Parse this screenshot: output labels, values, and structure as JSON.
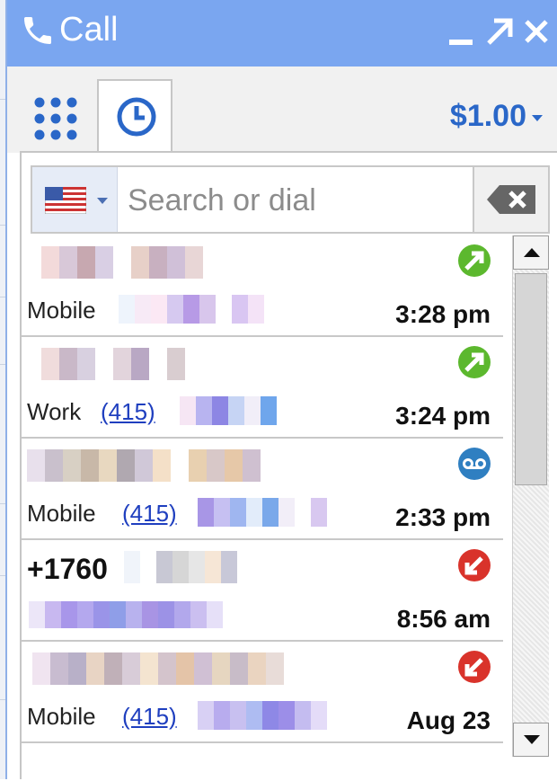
{
  "window": {
    "title": "Call",
    "phone_icon": "phone-icon",
    "minimize_icon": "minimize-icon",
    "popout_icon": "popout-icon",
    "close_icon": "close-icon",
    "color": "#7aa6f0"
  },
  "tabs": {
    "dialpad_icon": "dialpad-icon",
    "history_icon": "clock-icon",
    "credit": "$1.00"
  },
  "search": {
    "placeholder": "Search or dial",
    "value": "",
    "country_icon": "us-flag-icon",
    "clear_icon": "backspace-icon"
  },
  "calls": [
    {
      "name": "",
      "type": "Mobile",
      "area_code": "",
      "time": "3:28 pm",
      "status_icon": "outgoing-call-icon",
      "status_color": "#5cb82e"
    },
    {
      "name": "",
      "type": "Work",
      "area_code": "(415)",
      "time": "3:24 pm",
      "status_icon": "outgoing-call-icon",
      "status_color": "#5cb82e"
    },
    {
      "name": "",
      "type": "Mobile",
      "area_code": "(415)",
      "time": "2:33 pm",
      "status_icon": "voicemail-icon",
      "status_color": "#2f7fc1"
    },
    {
      "name": "+1760",
      "type": "",
      "area_code": "",
      "time": "8:56 am",
      "status_icon": "missed-call-icon",
      "status_color": "#d9332b"
    },
    {
      "name": "",
      "type": "Mobile",
      "area_code": "(415)",
      "time": "Aug 23",
      "status_icon": "missed-call-icon",
      "status_color": "#d9332b"
    }
  ]
}
